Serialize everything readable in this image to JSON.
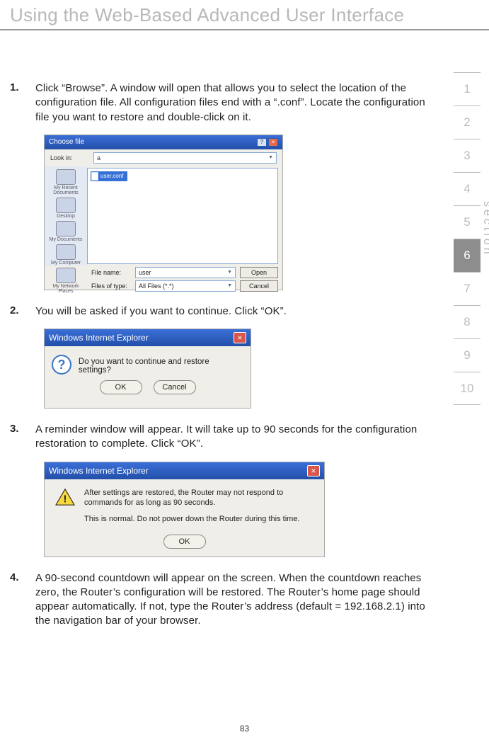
{
  "page_title": "Using the Web-Based Advanced User Interface",
  "page_number": "83",
  "section_label": "section",
  "section_tabs": [
    "1",
    "2",
    "3",
    "4",
    "5",
    "6",
    "7",
    "8",
    "9",
    "10"
  ],
  "active_tab_index": 5,
  "steps": [
    {
      "num": "1.",
      "text": "Click “Browse”. A window will open that allows you to select the location of the configuration file. All configuration files end with a “.conf”. Locate the configuration file you want to restore and double-click on it."
    },
    {
      "num": "2.",
      "text": "You will be asked if you want to continue. Click “OK”."
    },
    {
      "num": "3.",
      "text": "A reminder window will appear. It will take up to 90 seconds for the configuration restoration to complete. Click “OK”."
    },
    {
      "num": "4.",
      "text": "A 90-second countdown will appear on the screen. When the countdown reaches zero, the Router’s configuration will be restored. The Router’s home page should appear automatically. If not, type the Router’s address (default = 192.168.2.1) into the navigation bar of your browser."
    }
  ],
  "shot1": {
    "title": "Choose file",
    "lookin_label": "Look in:",
    "lookin_value": "a",
    "side_items": [
      "My Recent Documents",
      "Desktop",
      "My Documents",
      "My Computer",
      "My Network Places"
    ],
    "file_name": "user.conf",
    "fname_label": "File name:",
    "fname_value": "user",
    "ftype_label": "Files of type:",
    "ftype_value": "All Files (*.*)",
    "open_btn": "Open",
    "cancel_btn": "Cancel"
  },
  "shot2": {
    "title": "Windows Internet Explorer",
    "message": "Do you want to continue and restore settings?",
    "ok": "OK",
    "cancel": "Cancel"
  },
  "shot3": {
    "title": "Windows Internet Explorer",
    "line1": "After settings are restored, the Router may not respond to commands for as long as 90 seconds.",
    "line2": "This is normal. Do not power down the Router during this time.",
    "ok": "OK"
  }
}
